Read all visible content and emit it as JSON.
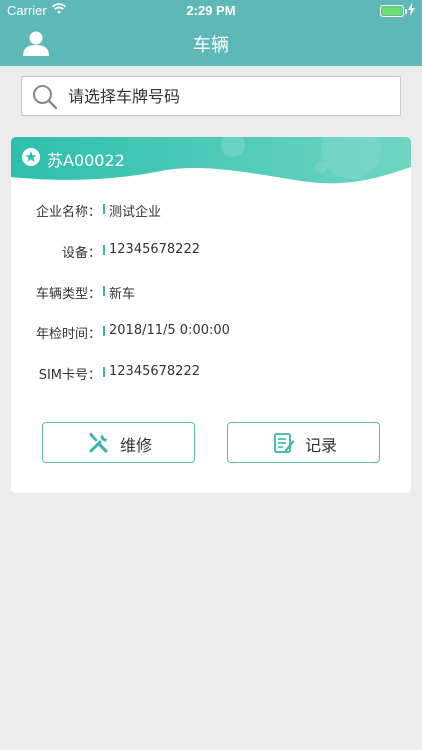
{
  "status_bar": {
    "carrier": "Carrier",
    "time": "2:29 PM"
  },
  "nav": {
    "title": "车辆",
    "left_icon": "user-icon"
  },
  "search": {
    "placeholder": "请选择车牌号码",
    "icon": "search-icon"
  },
  "vehicle": {
    "plate": "苏A00022",
    "fields": [
      {
        "label": "企业名称：",
        "value": "测试企业"
      },
      {
        "label": "设备：",
        "value": "12345678222"
      },
      {
        "label": "车辆类型：",
        "value": "新车"
      },
      {
        "label": "年检时间：",
        "value": "2018/11/5 0:00:00"
      },
      {
        "label": "SIM卡号：",
        "value": "12345678222"
      }
    ],
    "actions": {
      "repair_label": "维修",
      "record_label": "记录"
    }
  },
  "colors": {
    "nav_bg": "#5fb8b8",
    "accent": "#3ab3ad",
    "page_bg": "#ececec"
  }
}
